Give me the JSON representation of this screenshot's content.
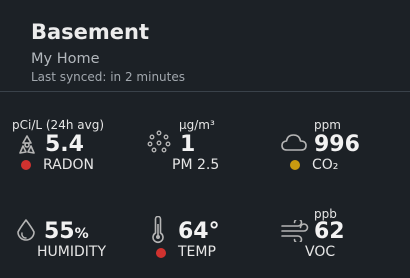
{
  "header": {
    "room_name": "Basement",
    "location": "My Home",
    "last_synced": "Last synced: in 2 minutes"
  },
  "colors": {
    "background": "#1c2126",
    "status_red": "#d0322f",
    "status_yellow": "#c99a10",
    "icon_gray": "#b5b5b5"
  },
  "sensors": [
    {
      "id": "radon",
      "unit": "pCi/L (24h avg)",
      "value": "5.4",
      "label": "RADON",
      "icon": "radiation-icon",
      "status": "red"
    },
    {
      "id": "pm25",
      "unit": "µg/m³",
      "value": "1",
      "label": "PM 2.5",
      "icon": "particles-icon",
      "status": "none"
    },
    {
      "id": "co2",
      "unit": "ppm",
      "value": "996",
      "label": "CO₂",
      "icon": "cloud-icon",
      "status": "yellow"
    },
    {
      "id": "humidity",
      "unit": "",
      "value": "55",
      "value_suffix": "%",
      "label": "HUMIDITY",
      "icon": "droplet-icon",
      "status": "none"
    },
    {
      "id": "temp",
      "unit": "",
      "value": "64°",
      "label": "TEMP",
      "icon": "thermometer-icon",
      "status": "red"
    },
    {
      "id": "voc",
      "unit": "ppb",
      "value": "62",
      "label": "VOC",
      "icon": "wind-icon",
      "status": "none"
    }
  ]
}
